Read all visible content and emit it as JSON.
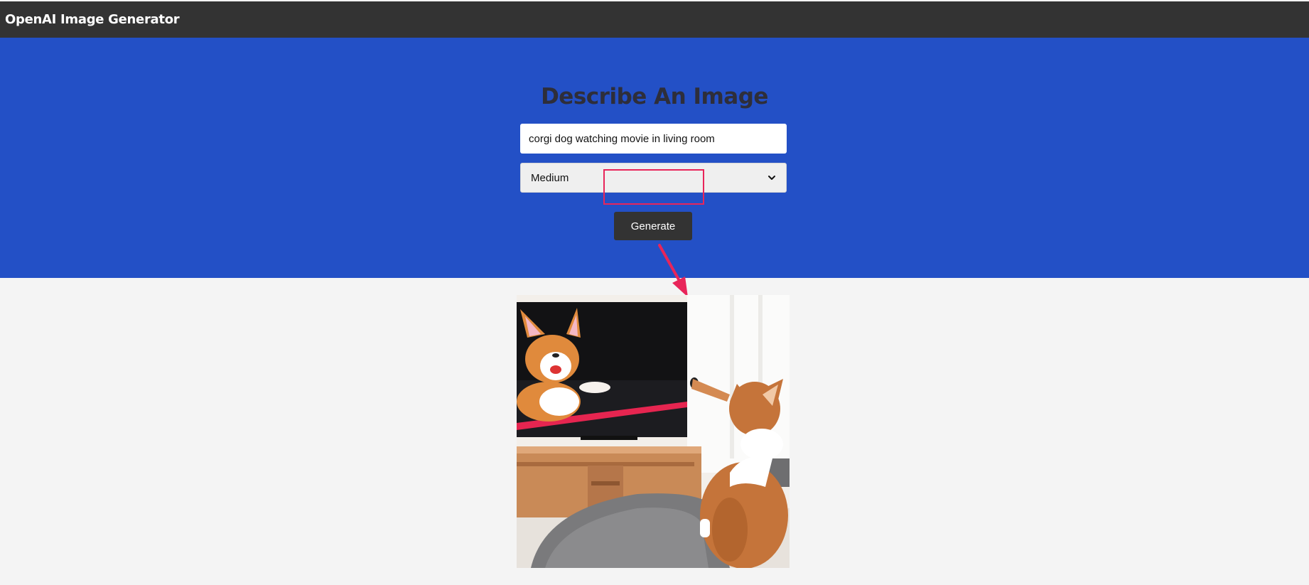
{
  "app": {
    "title": "OpenAI Image Generator"
  },
  "form": {
    "heading": "Describe An Image",
    "prompt_value": "corgi dog watching movie in living room",
    "size_selected": "Medium",
    "generate_label": "Generate"
  },
  "result": {
    "image_subject": "corgi dog watching movie in living room"
  },
  "icons": {
    "select_chevron": "chevron-down-icon"
  },
  "colors": {
    "navbar": "#333333",
    "showcase": "#2350c6",
    "page_background": "#f4f4f4",
    "button": "#333333",
    "annotation": "#e8255a"
  }
}
